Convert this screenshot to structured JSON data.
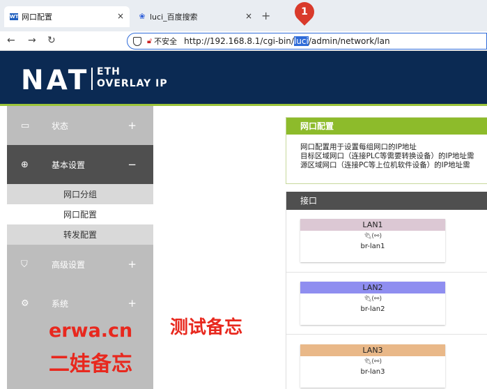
{
  "browser": {
    "tabs": [
      {
        "title": "网口配置",
        "favicon": "WT"
      },
      {
        "title": "luci_百度搜索",
        "favicon": "paw-icon"
      }
    ],
    "close_glyph": "×",
    "new_tab_glyph": "+",
    "badge_number": "1",
    "insecure_label": "不安全",
    "url_prefix": "http://192.168.8.1/cgi-bin/",
    "url_highlight": "luci",
    "url_suffix": "/admin/network/lan"
  },
  "header": {
    "logo_main": "NAT",
    "logo_line1": "ETH",
    "logo_line2": "OVERLAY IP"
  },
  "sidebar": {
    "menu": [
      {
        "label": "状态",
        "icon": "monitor-icon",
        "toggle": "+"
      },
      {
        "label": "基本设置",
        "icon": "globe-icon",
        "toggle": "−"
      },
      {
        "label": "高级设置",
        "icon": "shield-icon",
        "toggle": "+"
      },
      {
        "label": "系统",
        "icon": "gear-icon",
        "toggle": "+"
      }
    ],
    "submenu": [
      "网口分组",
      "网口配置",
      "转发配置"
    ],
    "watermark_line1": "erwa.cn",
    "watermark_line2": "二娃备忘"
  },
  "content": {
    "section_title": "网口配置",
    "description": [
      "网口配置用于设置每组网口的IP地址",
      "目标区域网口（连接PLC等需要转换设备）的IP地址需",
      "源区域网口（连接PC等上位机软件设备）的IP地址需"
    ],
    "interface_header": "接口",
    "interfaces": [
      {
        "name": "LAN1",
        "device": "br-lan1",
        "color": "#dcc8d4"
      },
      {
        "name": "LAN2",
        "device": "br-lan2",
        "color": "#8f8ef0"
      },
      {
        "name": "LAN3",
        "device": "br-lan3",
        "color": "#e9b888"
      }
    ],
    "memo": "测试备忘"
  }
}
